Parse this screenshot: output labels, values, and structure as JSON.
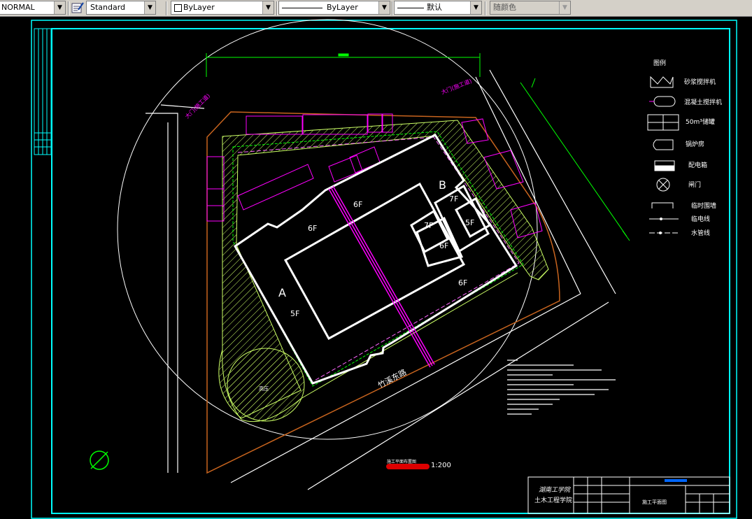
{
  "toolbar": {
    "plot_style": "NORMAL",
    "text_style": "Standard",
    "layer": "ByLayer",
    "linetype": "ByLayer",
    "lineweight": "默认",
    "color": "随颜色"
  },
  "colors": {
    "canvas": "#000000",
    "frame": "#00ffff",
    "building": "#ffffff",
    "site_boundary": "#c8641e",
    "green_zone": "#ccff66",
    "label": "#ff00ff",
    "dimension": "#00ff00",
    "axis_line": "#ff00ff",
    "scale_bar": "#dd0000"
  },
  "drawing": {
    "building_labels": [
      "A",
      "B",
      "6F",
      "5F",
      "6F",
      "7F",
      "7F",
      "6F",
      "5F",
      "6F"
    ],
    "road_label": "竹溪东路",
    "site_label": "高压",
    "gate_labels": [
      "大门(施工道)",
      "大门(施工道)"
    ],
    "plan_title": "施工平面布置图",
    "scale": "1:200"
  },
  "legend": {
    "title": "图例",
    "items": [
      {
        "icon": "mixer-icon",
        "label": "砂浆搅拌机"
      },
      {
        "icon": "concrete-mixer-icon",
        "label": "混凝土搅拌机"
      },
      {
        "icon": "dump-icon",
        "label": "50m³储罐"
      },
      {
        "icon": "boiler-icon",
        "label": "锅炉房"
      },
      {
        "icon": "box-icon",
        "label": "配电箱"
      },
      {
        "icon": "valve-icon",
        "label": "闸门"
      },
      {
        "icon": "fence-icon",
        "label": "临时围墙"
      },
      {
        "icon": "power-line-icon",
        "label": "临电线"
      },
      {
        "icon": "water-line-icon",
        "label": "水管线"
      }
    ]
  },
  "title_block": {
    "school": "湖南工学院",
    "dept": "土木工程学院",
    "drawing_name": "施工平面图"
  }
}
